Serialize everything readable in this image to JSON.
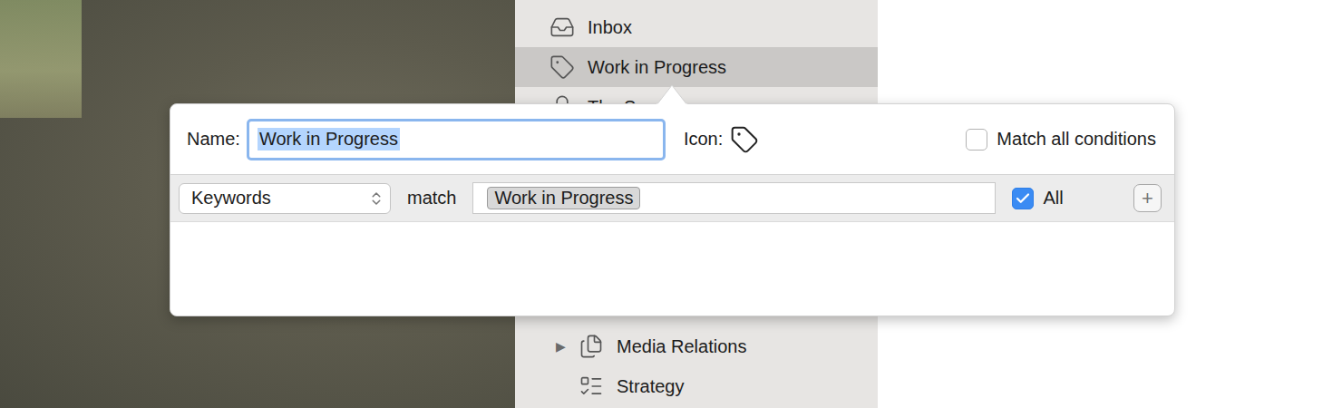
{
  "sidebar": {
    "items": [
      {
        "label": "Inbox",
        "kind": "inbox",
        "selected": false
      },
      {
        "label": "Work in Progress",
        "kind": "tag",
        "selected": true
      },
      {
        "label": "The S",
        "kind": "group",
        "selected": false,
        "expanded": true,
        "disclosure": "▼",
        "children": [
          {
            "label": "Media Relations",
            "kind": "document",
            "selected": false,
            "expanded": false,
            "disclosure": "▶"
          },
          {
            "label": "Strategy",
            "kind": "list",
            "selected": false
          }
        ]
      }
    ]
  },
  "popover": {
    "name_label": "Name:",
    "name_value": "Work in Progress",
    "name_selected": true,
    "icon_label": "Icon:",
    "match_all": {
      "label": "Match all conditions",
      "checked": false
    },
    "conditions": [
      {
        "field": "Keywords",
        "operator": "match",
        "tokens": [
          "Work in Progress"
        ],
        "all": {
          "label": "All",
          "checked": true
        },
        "add_button": "+"
      }
    ]
  }
}
